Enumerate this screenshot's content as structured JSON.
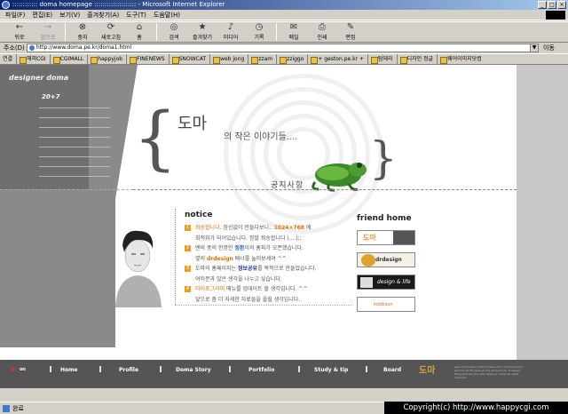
{
  "window": {
    "title": ":::::::::::: doma homepage :::::::::::::::::::: - Microsoft Internet Explorer",
    "minimize_icon": "_",
    "maximize_icon": "□",
    "close_icon": "×"
  },
  "menu": [
    "파일(F)",
    "편집(E)",
    "보기(V)",
    "즐겨찾기(A)",
    "도구(T)",
    "도움말(H)"
  ],
  "toolbar": [
    {
      "label": "뒤로",
      "icon": "back-arrow-icon",
      "glyph": "←",
      "enabled": true
    },
    {
      "label": "앞으로",
      "icon": "forward-arrow-icon",
      "glyph": "→",
      "enabled": false
    },
    {
      "label": "중지",
      "icon": "stop-icon",
      "glyph": "⊗",
      "enabled": true
    },
    {
      "label": "새로고침",
      "icon": "refresh-icon",
      "glyph": "⟳",
      "enabled": true
    },
    {
      "label": "홈",
      "icon": "home-icon",
      "glyph": "⌂",
      "enabled": true
    },
    {
      "label": "검색",
      "icon": "search-icon",
      "glyph": "◎",
      "enabled": true
    },
    {
      "label": "즐겨찾기",
      "icon": "favorites-icon",
      "glyph": "★",
      "enabled": true
    },
    {
      "label": "미디어",
      "icon": "media-icon",
      "glyph": "♪",
      "enabled": true
    },
    {
      "label": "기록",
      "icon": "history-icon",
      "glyph": "◷",
      "enabled": true
    },
    {
      "label": "메일",
      "icon": "mail-icon",
      "glyph": "✉",
      "enabled": true
    },
    {
      "label": "인쇄",
      "icon": "print-icon",
      "glyph": "⎙",
      "enabled": true
    },
    {
      "label": "편집",
      "icon": "edit-icon",
      "glyph": "✎",
      "enabled": true
    }
  ],
  "address": {
    "label": "주소(D)",
    "url": "http://www.doma.pe.kr/doma1.html",
    "go": "이동"
  },
  "links": {
    "label": "연결",
    "items": [
      "해피CGI",
      "CGIMALL",
      "happyjob",
      "FINENEWS",
      "SNOWCAT",
      "web jong",
      "zzam",
      "zziggo",
      "+ geston.pe.kr +",
      "탐데리",
      "디자인 정글",
      "웨어이미지닷컴"
    ]
  },
  "page": {
    "brand": "designer doma",
    "number": "20+7",
    "hero": {
      "main": "도마",
      "sub": "의 작은 이야기들....",
      "notice_word": "공지사항"
    },
    "notice": {
      "title": "notice",
      "items": [
        {
          "num": "1",
          "parts": [
            {
              "t": "죄송합니다",
              "c": "hl-orange"
            },
            {
              "t": ". 정신없이 만들다보니.. ",
              "c": ""
            },
            {
              "t": "1024×768",
              "c": "hl-orange-b"
            },
            {
              "t": " 에",
              "c": ""
            }
          ]
        },
        {
          "num": "",
          "parts": [
            {
              "t": "최적화가 되어있습니다. 정말 죄송합니다 (....);;",
              "c": ""
            }
          ]
        },
        {
          "num": "2",
          "parts": [
            {
              "t": "밴비 중의 한명인 ",
              "c": ""
            },
            {
              "t": "정환",
              "c": "hl-blue"
            },
            {
              "t": "이의 홈피가 오픈했습니다.",
              "c": ""
            }
          ]
        },
        {
          "num": "",
          "parts": [
            {
              "t": "옆의 ",
              "c": ""
            },
            {
              "t": "drdesign",
              "c": "hl-orange-b"
            },
            {
              "t": " 배너를 눌러보세여 ^^",
              "c": ""
            }
          ]
        },
        {
          "num": "3",
          "parts": [
            {
              "t": "도마의 홈페이지는 ",
              "c": ""
            },
            {
              "t": "정보공유",
              "c": "hl-dblue"
            },
            {
              "t": "를 목적으로 만들었습니다.",
              "c": ""
            }
          ]
        },
        {
          "num": "",
          "parts": [
            {
              "t": "여러분과 많은 생각을 나누고 싶습니다.",
              "c": ""
            }
          ]
        },
        {
          "num": "4",
          "parts": [
            {
              "t": "타이포그라피",
              "c": "hl-orange"
            },
            {
              "t": " 메뉴를 업데이트 할 생각입니다. ^^",
              "c": ""
            }
          ]
        },
        {
          "num": "",
          "parts": [
            {
              "t": "앞으로 좀 더 자세한 자료들을 올릴 생각입니다.",
              "c": ""
            }
          ]
        }
      ]
    },
    "friend_home": {
      "title": "friend home",
      "banners": [
        {
          "text": "도마",
          "style": "logo"
        },
        {
          "text": "drdesign",
          "style": "dr"
        },
        {
          "text": "design & life",
          "style": "dark"
        },
        {
          "text": "hobbsun",
          "style": "plain"
        }
      ]
    },
    "nav": [
      {
        "label": "Home"
      },
      {
        "label": "Profile"
      },
      {
        "label": "Doma Story"
      },
      {
        "label": "Portfolio"
      },
      {
        "label": "Study & tip"
      },
      {
        "label": "Board"
      }
    ],
    "nav_extra": "on",
    "footer_logo": "도마",
    "footer_tiny": "web information. Doma's home for a nice time and we look all the lines on the general info of design. thing and also this also designer doma all rights reserved"
  },
  "status": {
    "text": "완료"
  },
  "copyright": "Copyright(c) http://www.happycgi.com"
}
